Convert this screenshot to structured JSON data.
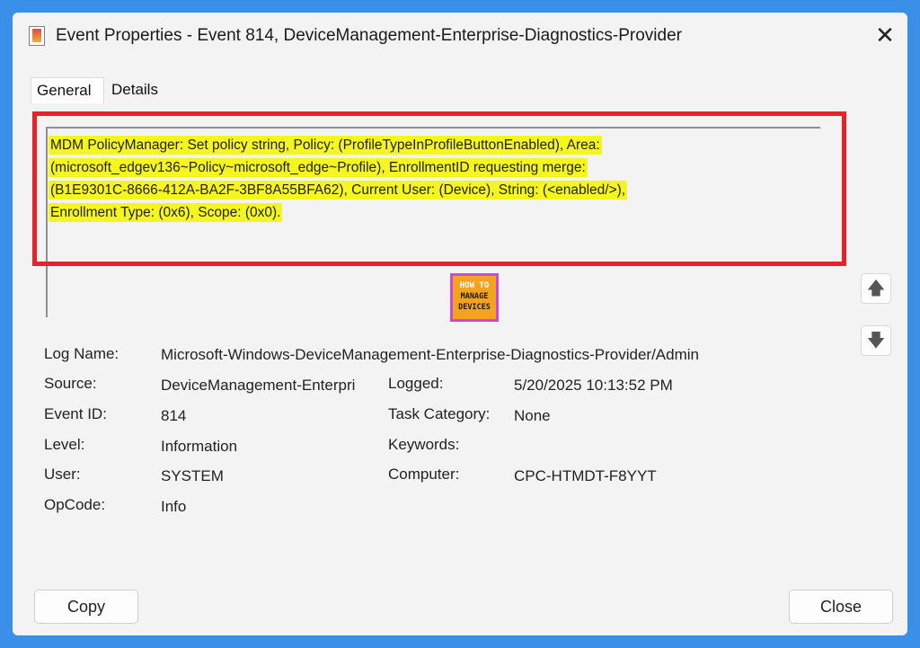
{
  "window": {
    "title": "Event Properties - Event 814, DeviceManagement-Enterprise-Diagnostics-Provider",
    "close_glyph": "✕"
  },
  "tabs": [
    {
      "label": "General",
      "active": true
    },
    {
      "label": "Details",
      "active": false
    }
  ],
  "message": {
    "lines": [
      "MDM PolicyManager: Set policy string, Policy: (ProfileTypeInProfileButtonEnabled), Area:",
      "(microsoft_edgev136~Policy~microsoft_edge~Profile), EnrollmentID requesting merge:",
      "(B1E9301C-8666-412A-BA2F-3BF8A55BFA62), Current User: (Device), String: (<enabled/>),",
      "Enrollment Type: (0x6), Scope: (0x0)."
    ],
    "highlight_color": "#f5f520",
    "frame_color": "#e8212b"
  },
  "logo": {
    "top": "HOW TO",
    "bottom_line1": "MANAGE",
    "bottom_line2": "DEVICES"
  },
  "fields": {
    "log_name_label": "Log Name:",
    "log_name": "Microsoft-Windows-DeviceManagement-Enterprise-Diagnostics-Provider/Admin",
    "source_label": "Source:",
    "source": "DeviceManagement-Enterpri",
    "logged_label": "Logged:",
    "logged": "5/20/2025 10:13:52 PM",
    "event_id_label": "Event ID:",
    "event_id": "814",
    "task_category_label": "Task Category:",
    "task_category": "None",
    "level_label": "Level:",
    "level": "Information",
    "keywords_label": "Keywords:",
    "keywords": "",
    "user_label": "User:",
    "user": "SYSTEM",
    "computer_label": "Computer:",
    "computer": "CPC-HTMDT-F8YYT",
    "opcode_label": "OpCode:",
    "opcode": "Info"
  },
  "buttons": {
    "copy": "Copy",
    "close": "Close"
  },
  "icons": {
    "up": "up-arrow-icon",
    "down": "down-arrow-icon"
  }
}
